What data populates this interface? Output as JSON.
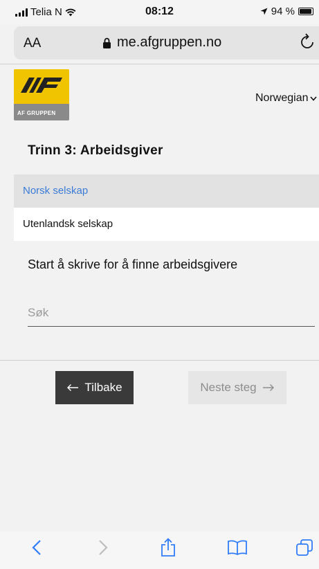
{
  "status_bar": {
    "carrier": "Telia N",
    "time": "08:12",
    "battery": "94 %",
    "battery_level": 0.94
  },
  "browser": {
    "text_size_label": "AA",
    "url": "me.afgruppen.no"
  },
  "logo": {
    "band_text": "AF GRUPPEN"
  },
  "language": {
    "selected": "Norwegian"
  },
  "step": {
    "title": "Trinn 3: Arbeidsgiver"
  },
  "company_type": {
    "options": [
      "Norsk selskap",
      "Utenlandsk selskap"
    ],
    "selected": "Norsk selskap"
  },
  "search": {
    "label": "Start å skrive for å finne arbeidsgivere",
    "placeholder": "Søk",
    "value": ""
  },
  "nav": {
    "back_label": "Tilbake",
    "next_label": "Neste steg"
  },
  "colors": {
    "logo_yellow": "#f0c400",
    "selected_tab_text": "#3b7bd6",
    "back_button_bg": "#3a3a3a",
    "ios_blue": "#2f7cf6"
  }
}
